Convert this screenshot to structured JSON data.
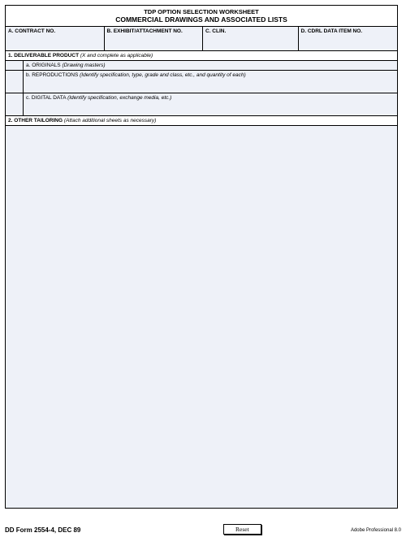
{
  "header": {
    "title": "TDP OPTION SELECTION WORKSHEET",
    "subtitle": "COMMERCIAL DRAWINGS AND ASSOCIATED LISTS"
  },
  "topCells": {
    "a": "A.  CONTRACT NO.",
    "b": "B.  EXHIBIT/ATTACHMENT NO.",
    "c": "C.  CLIN.",
    "d": "D.  CDRL DATA ITEM NO."
  },
  "section1": {
    "label": "1.  DELIVERABLE PRODUCT",
    "hint": "(X and complete as applicable)",
    "rows": {
      "a": {
        "letter": "a.",
        "label": "ORIGINALS",
        "hint": "(Drawing masters)"
      },
      "b": {
        "letter": "b.",
        "label": "REPRODUCTIONS",
        "hint": "(Identify specification, type, grade and class, etc., and quantity of each)"
      },
      "c": {
        "letter": "c.",
        "label": "DIGITAL DATA",
        "hint": "(Identify specification, exchange media, etc.)"
      }
    }
  },
  "section2": {
    "label": "2.  OTHER TAILORING",
    "hint": "(Attach additional sheets as necessary)"
  },
  "footer": {
    "left": "DD Form 2554-4, DEC 89",
    "right": "Adobe Professional 8.0",
    "reset": "Reset"
  }
}
